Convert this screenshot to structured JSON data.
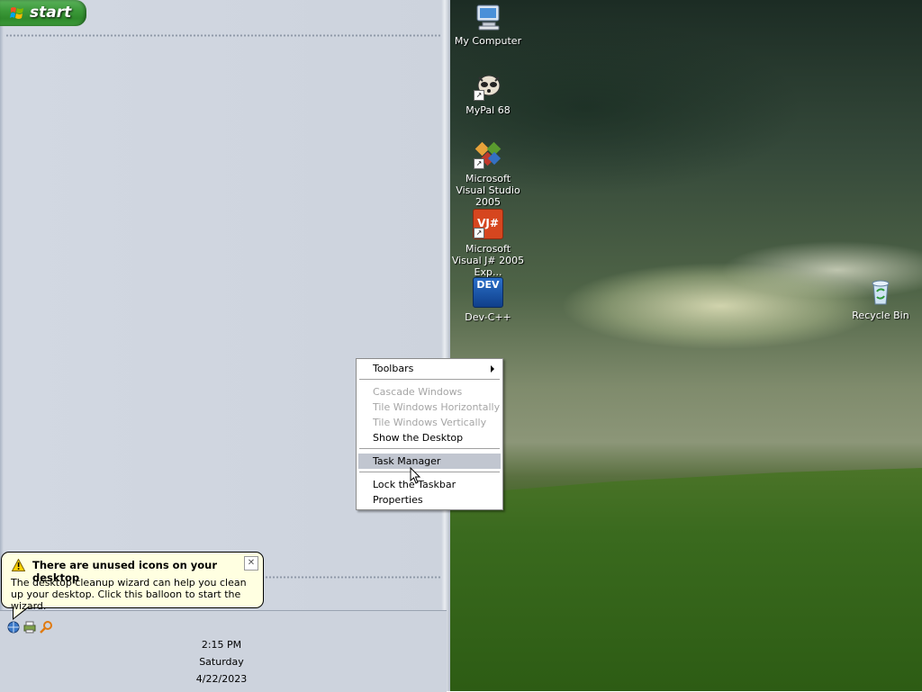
{
  "start": {
    "label": "start"
  },
  "desktop_icons": [
    {
      "label": "My Computer",
      "icon": "computer-icon"
    },
    {
      "label": "MyPal 68",
      "icon": "mypal-browser-icon"
    },
    {
      "label": "Microsoft Visual Studio 2005",
      "icon": "visual-studio-icon"
    },
    {
      "label": "Microsoft Visual J# 2005 Exp...",
      "icon": "visual-jsharp-icon",
      "badge": "VJ#"
    },
    {
      "label": "Dev-C++",
      "icon": "dev-cpp-icon",
      "badge": "DEV"
    },
    {
      "label": "Recycle Bin",
      "icon": "recycle-bin-icon"
    }
  ],
  "context_menu": {
    "items": [
      {
        "label": "Toolbars",
        "enabled": true,
        "submenu": true
      },
      {
        "label": "Cascade Windows",
        "enabled": false
      },
      {
        "label": "Tile Windows Horizontally",
        "enabled": false
      },
      {
        "label": "Tile Windows Vertically",
        "enabled": false
      },
      {
        "label": "Show the Desktop",
        "enabled": true
      },
      {
        "label": "Task Manager",
        "enabled": true,
        "highlighted": true
      },
      {
        "label": "Lock the Taskbar",
        "enabled": true
      },
      {
        "label": "Properties",
        "enabled": true
      }
    ]
  },
  "balloon": {
    "title": "There are unused icons on your desktop",
    "body": "The desktop cleanup wizard can help you clean up your desktop. Click this balloon to start the wizard.",
    "close_glyph": "✕"
  },
  "tray": {
    "icons": [
      "network-icon",
      "printer-icon",
      "search-icon"
    ]
  },
  "clock": {
    "time": "2:15 PM",
    "day": "Saturday",
    "date": "4/22/2023"
  },
  "colors": {
    "start_green": "#3c9a3a",
    "taskbar": "#cdd3dd",
    "balloon_bg": "#ffffe1",
    "menu_highlight": "#c1c6d0"
  }
}
